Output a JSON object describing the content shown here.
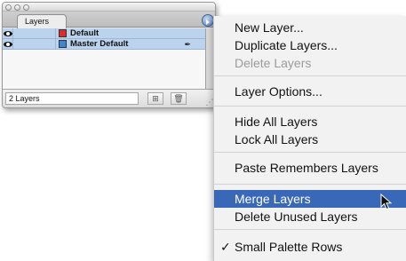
{
  "palette": {
    "tab_label": "Layers",
    "layers": [
      {
        "name": "Default",
        "color": "#e02a2a"
      },
      {
        "name": "Master Default",
        "color": "#3f86d0"
      }
    ],
    "status": "2 Layers"
  },
  "menu": {
    "items": [
      {
        "label": "New Layer...",
        "enabled": true
      },
      {
        "label": "Duplicate Layers...",
        "enabled": true
      },
      {
        "label": "Delete Layers",
        "enabled": false
      },
      {
        "label": "Layer Options...",
        "enabled": true
      },
      {
        "label": "Hide All Layers",
        "enabled": true
      },
      {
        "label": "Lock All Layers",
        "enabled": true
      },
      {
        "label": "Paste Remembers Layers",
        "enabled": true
      },
      {
        "label": "Merge Layers",
        "enabled": true,
        "selected": true
      },
      {
        "label": "Delete Unused Layers",
        "enabled": true
      },
      {
        "label": "Small Palette Rows",
        "enabled": true,
        "checked": true,
        "check_glyph": "✓"
      }
    ]
  },
  "colors": {
    "menu_highlight": "#3a68b9",
    "disabled_text": "#9b9b9b",
    "layer_selection": "#bcd3ee"
  },
  "icons": [
    "eye-icon",
    "pen-icon",
    "new-layer-icon",
    "trash-icon",
    "resize-grip-icon",
    "palette-menu-icon",
    "mouse-pointer-icon"
  ]
}
